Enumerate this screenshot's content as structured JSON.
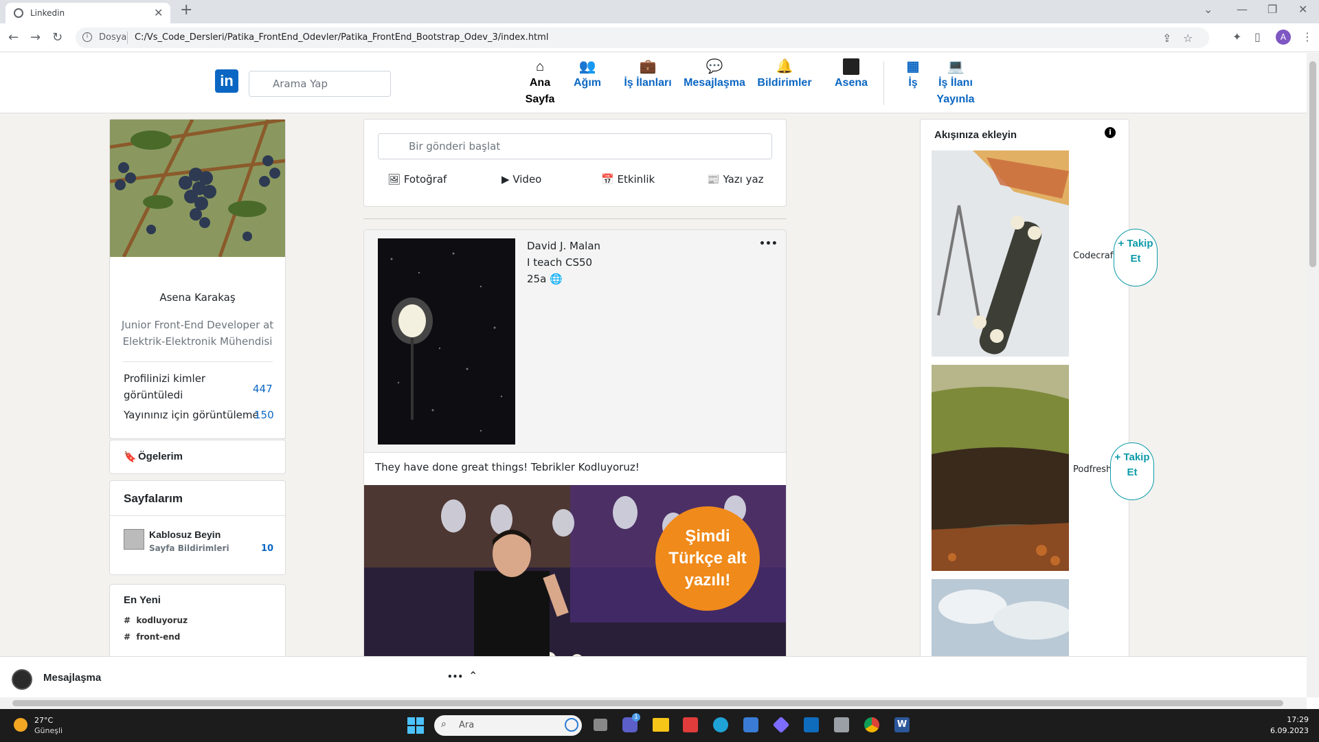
{
  "browser": {
    "tab_title": "Linkedin",
    "scheme_label": "Dosya",
    "url": "C:/Vs_Code_Dersleri/Patika_FrontEnd_Odevler/Patika_FrontEnd_Bootstrap_Odev_3/index.html",
    "profile_initial": "A"
  },
  "header": {
    "search_placeholder": "Arama Yap",
    "nav": [
      {
        "label": "Ana Sayfa",
        "icon": "home-icon"
      },
      {
        "label": "Ağım",
        "icon": "people-icon"
      },
      {
        "label": "İş İlanları",
        "icon": "briefcase-icon"
      },
      {
        "label": "Mesajlaşma",
        "icon": "chat-icon"
      },
      {
        "label": "Bildirimler",
        "icon": "bell-icon"
      },
      {
        "label": "Asena",
        "icon": "avatar"
      },
      {
        "label": "İş",
        "icon": "grid-icon"
      },
      {
        "label": "İş İlanı Yayınla",
        "icon": "laptop-icon"
      }
    ]
  },
  "profile": {
    "name": "Asena Karakaş",
    "job": "Junior Front-End Developer at Elektrik-Elektronik Mühendisi",
    "stats": [
      {
        "label": "Profilinizi kimler görüntüledi",
        "value": "447"
      },
      {
        "label": "Yayınınız için görüntüleme",
        "value": "150"
      }
    ],
    "items_label": "Ögelerim"
  },
  "pages": {
    "title": "Sayfalarım",
    "page_name": "Kablosuz Beyin",
    "page_sub": "Sayfa Bildirimleri",
    "page_count": "10"
  },
  "latest": {
    "title": "En Yeni",
    "tags": [
      "kodluyoruz",
      "front-end"
    ]
  },
  "composer": {
    "placeholder": "Bir gönderi başlat",
    "actions": [
      "Fotoğraf",
      "Video",
      "Etkinlik",
      "Yazı yaz"
    ]
  },
  "post": {
    "author": "David J. Malan",
    "headline": "I teach CS50",
    "time": "25a",
    "more": "•••",
    "text": "They have done great things! Tebrikler Kodluyoruz!",
    "badge": "Şimdi Türkçe alt yazılı!"
  },
  "feed": {
    "title": "Akışınıza ekleyin",
    "follow_label": "+ Takip Et",
    "items": [
      {
        "name": "Codecraft"
      },
      {
        "name": "Podfresh"
      }
    ]
  },
  "messaging": {
    "label": "Mesajlaşma",
    "more": "•••"
  },
  "taskbar": {
    "temp": "27°C",
    "weather": "Güneşli",
    "search_placeholder": "Ara",
    "time": "17:29",
    "date": "6.09.2023",
    "chat_badge": "1"
  }
}
